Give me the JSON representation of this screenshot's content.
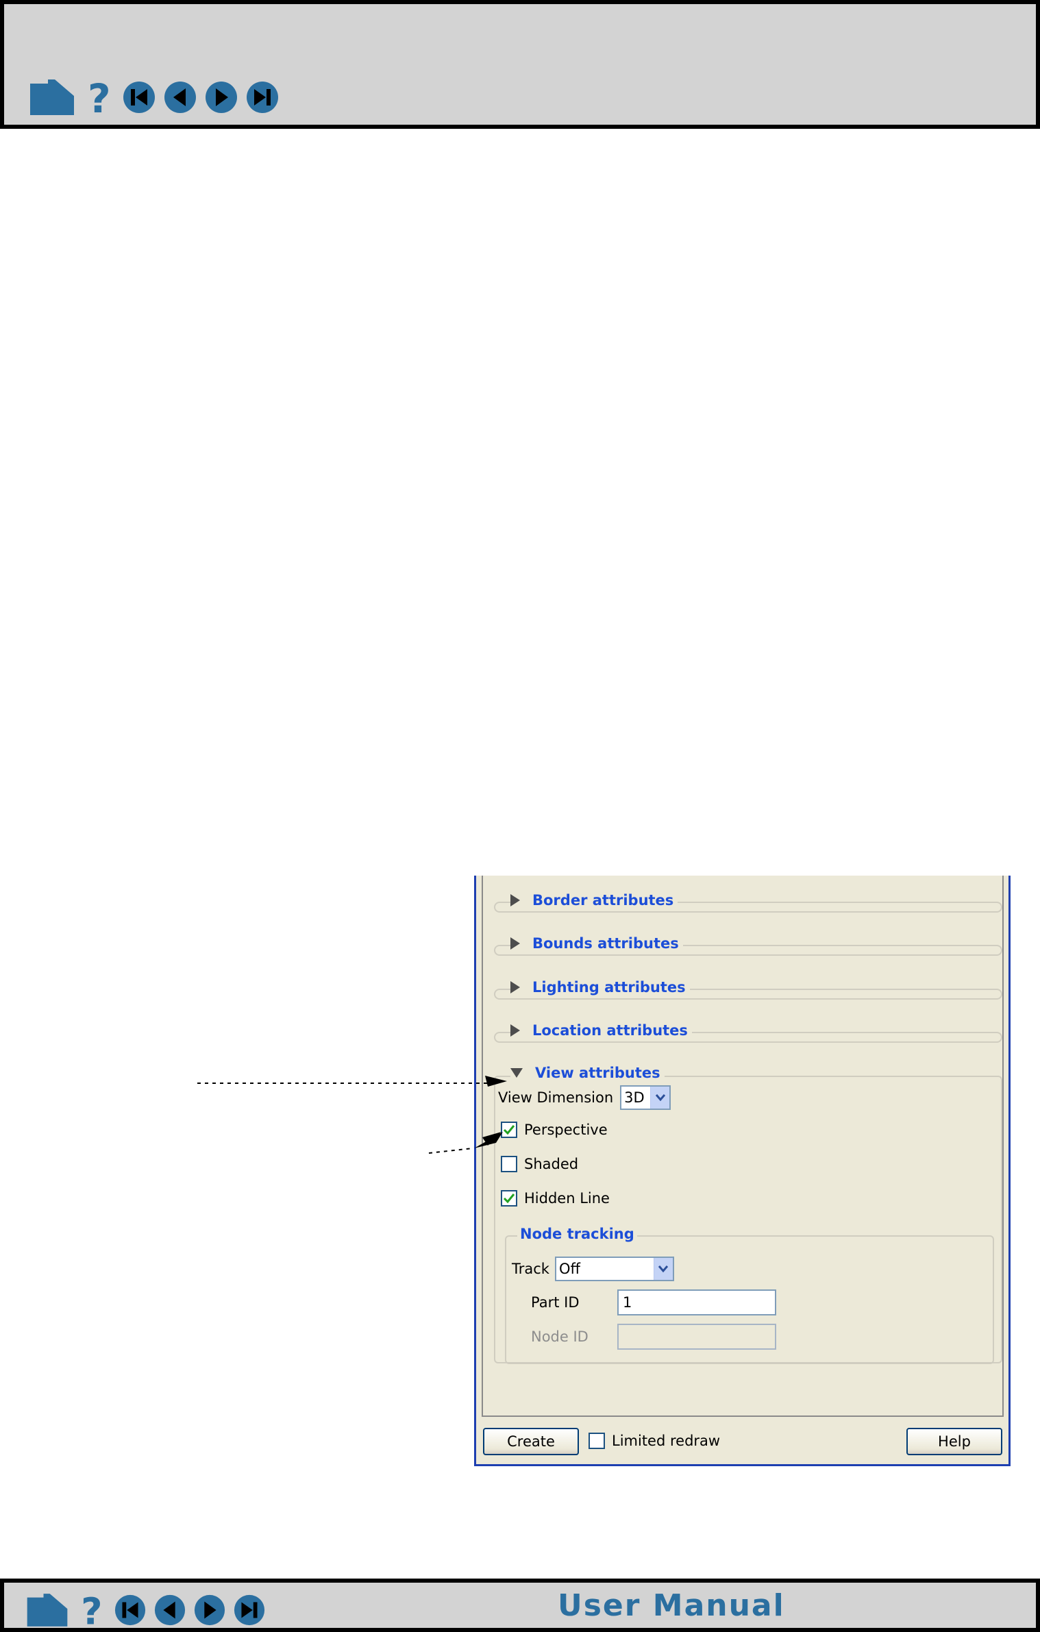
{
  "footer": {
    "manual_title": "User Manual"
  },
  "dialog": {
    "sections": [
      {
        "title": "Border attributes"
      },
      {
        "title": "Bounds attributes"
      },
      {
        "title": "Lighting attributes"
      },
      {
        "title": "Location attributes"
      },
      {
        "title": "View attributes"
      }
    ],
    "view": {
      "dimension_label": "View Dimension",
      "dimension_value": "3D",
      "perspective_label": "Perspective",
      "perspective_checked": true,
      "shaded_label": "Shaded",
      "shaded_checked": false,
      "hidden_line_label": "Hidden Line",
      "hidden_line_checked": true
    },
    "node_tracking": {
      "title": "Node tracking",
      "track_label": "Track",
      "track_value": "Off",
      "part_id_label": "Part ID",
      "part_id_value": "1",
      "node_id_label": "Node ID",
      "node_id_value": ""
    },
    "footer": {
      "create_label": "Create",
      "limited_redraw_label": "Limited redraw",
      "limited_redraw_checked": false,
      "help_label": "Help"
    }
  },
  "colors": {
    "nav_blue": "#2b6fa0",
    "section_title": "#1c4ed8",
    "dialog_bg": "#ece9d8",
    "dialog_border": "#1e3fb0"
  },
  "icons": [
    "home-icon",
    "help-icon",
    "first-page-icon",
    "previous-page-icon",
    "next-page-icon",
    "last-page-icon",
    "check-icon",
    "dropdown-arrow-icon"
  ]
}
